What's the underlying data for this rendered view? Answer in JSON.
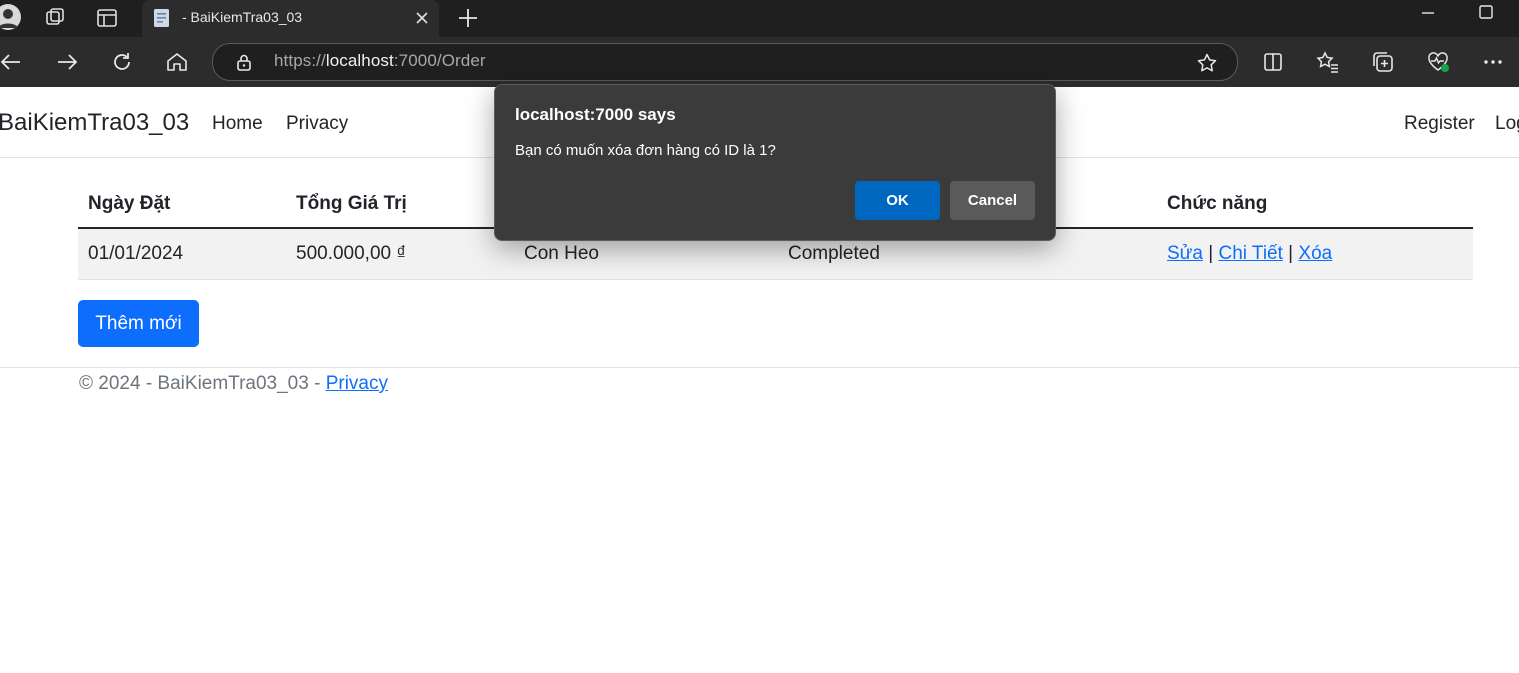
{
  "browser": {
    "tab_title": "- BaiKiemTra03_03",
    "url_scheme": "https://",
    "url_host": "localhost",
    "url_rest": ":7000/Order"
  },
  "nav": {
    "brand": "BaiKiemTra03_03",
    "links": [
      "Home",
      "Privacy"
    ],
    "right_links": [
      "Register",
      "Log"
    ]
  },
  "table": {
    "headers": [
      "Ngày Đặt",
      "Tổng Giá Trị",
      "",
      "",
      "Chức năng"
    ],
    "rows": [
      {
        "date": "01/01/2024",
        "total": "500.000,00 ₫",
        "customer": "Con Heo",
        "status": "Completed",
        "actions": [
          "Sửa",
          "Chi Tiết",
          "Xóa"
        ],
        "separator": "|"
      }
    ]
  },
  "add_button": "Thêm mới",
  "footer": {
    "text": "© 2024 - BaiKiemTra03_03 - ",
    "link": "Privacy"
  },
  "dialog": {
    "title": "localhost:7000 says",
    "message": "Bạn có muốn xóa đơn hàng có ID là 1?",
    "ok": "OK",
    "cancel": "Cancel"
  },
  "colors": {
    "chrome_dark": "#1f1f1f",
    "toolbar": "#2c2c2c",
    "primary": "#0d6efd",
    "dialog_bg": "#3b3b3b",
    "dialog_ok": "#0067c0"
  }
}
